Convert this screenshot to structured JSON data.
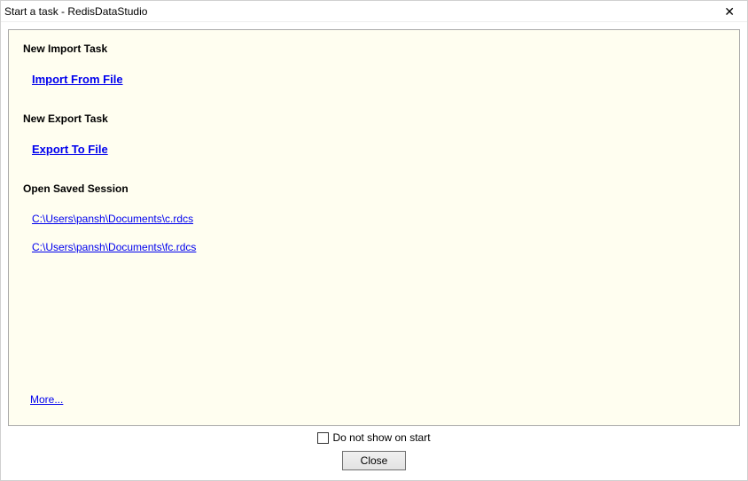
{
  "window": {
    "title": "Start a task - RedisDataStudio",
    "close_glyph": "✕"
  },
  "sections": {
    "import_header": "New Import Task",
    "import_link": "Import From File",
    "export_header": "New Export Task",
    "export_link": "Export To File",
    "session_header": "Open Saved Session"
  },
  "sessions": [
    "C:\\Users\\pansh\\Documents\\c.rdcs",
    "C:\\Users\\pansh\\Documents\\fc.rdcs"
  ],
  "more_label": "More...",
  "footer": {
    "checkbox_label": "Do not show on start",
    "close_button": "Close"
  }
}
